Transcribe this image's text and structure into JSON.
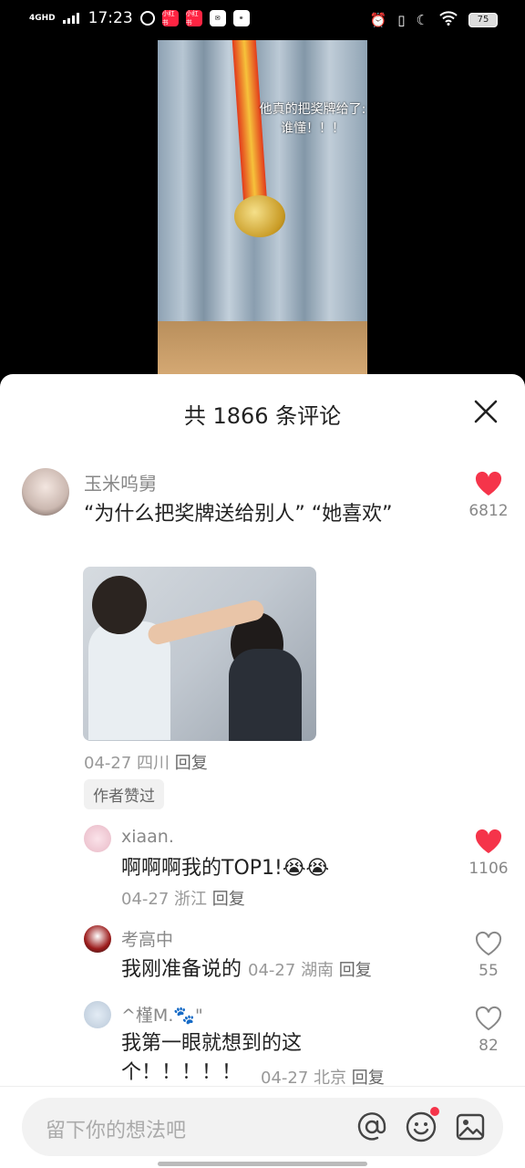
{
  "status_bar": {
    "network": "4GHD",
    "time": "17:23",
    "app_icon_1": "小红书",
    "app_icon_2": "小红书",
    "battery": "75"
  },
  "video": {
    "caption_line1": "他真的把奖牌给了:",
    "caption_line2": "谁懂！！！"
  },
  "comments_header": {
    "title": "共 1866 条评论"
  },
  "comments": [
    {
      "username": "玉米呜舅",
      "text": "“为什么把奖牌送给别人” “她喜欢”",
      "date": "04-27",
      "location": "四川",
      "reply_label": "回复",
      "tag": "作者赞过",
      "likes": "6812",
      "liked": true
    }
  ],
  "replies": [
    {
      "username": "xiaan.",
      "text": "啊啊啊我的TOP1!",
      "date": "04-27",
      "location": "浙江",
      "reply_label": "回复",
      "likes": "1106",
      "liked": true
    },
    {
      "username": "考高中",
      "text": "我刚准备说的",
      "date": "04-27",
      "location": "湖南",
      "reply_label": "回复",
      "likes": "55",
      "liked": false
    },
    {
      "username": "^槿M.🐾\"",
      "text": "我第一眼就想到的这个！！！！！",
      "date": "04-27",
      "location": "北京",
      "reply_label": "回复",
      "likes": "82",
      "liked": false
    }
  ],
  "input": {
    "placeholder": "留下你的想法吧"
  },
  "colors": {
    "like_red": "#f5344a",
    "text_dark": "#222222",
    "text_gray": "#888888"
  }
}
